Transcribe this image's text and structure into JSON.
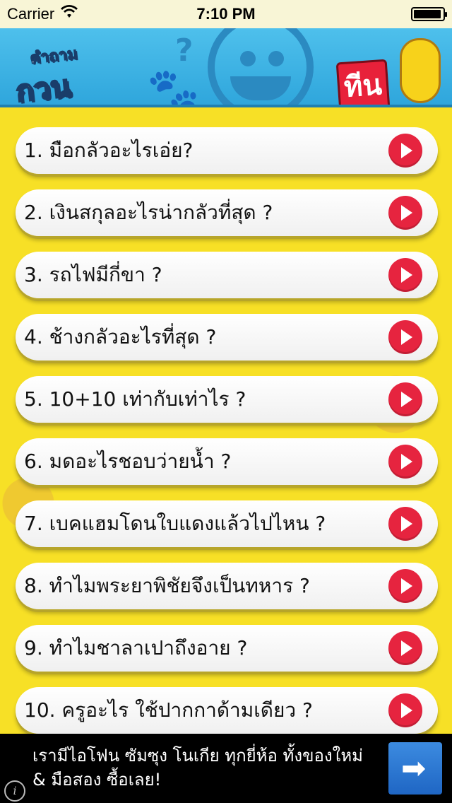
{
  "status_bar": {
    "carrier": "Carrier",
    "time": "7:10 PM",
    "battery_level": 0.95
  },
  "header": {
    "logo_left_line1": "คำถาม",
    "logo_left_line2": "กวน",
    "logo_right_text": "ทีน",
    "colors": {
      "sky": "#4ec0ec",
      "accent_yellow": "#f7d21b",
      "accent_red": "#e8213a"
    }
  },
  "questions": [
    {
      "label": "1.  มือกลัวอะไรเอ่ย?"
    },
    {
      "label": "2. เงินสกุลอะไรน่ากลัวที่สุด ?"
    },
    {
      "label": "3. รถไฟมีกี่ขา ?"
    },
    {
      "label": "4. ช้างกลัวอะไรที่สุด ?"
    },
    {
      "label": "5. 10+10 เท่ากับเท่าไร ?"
    },
    {
      "label": "6. มดอะไรชอบว่ายน้ำ ?"
    },
    {
      "label": "7. เบคแฮมโดนใบแดงแล้วไปไหน ?"
    },
    {
      "label": "8. ทำไมพระยาพิชัยจึงเป็นทหาร  ?"
    },
    {
      "label": "9. ทำไมชาลาเปาถึงอาย ?"
    },
    {
      "label": "10. ครูอะไร ใช้ปากกาด้ามเดียว  ?"
    }
  ],
  "ad": {
    "text": "เรามีไอโฟน ซัมซุง โนเกีย ทุกยี่ห้อ ทั้งของใหม่ & มือสอง ซื้อเลย!",
    "arrow_icon": "arrow-right-icon",
    "info_icon": "info-icon"
  }
}
